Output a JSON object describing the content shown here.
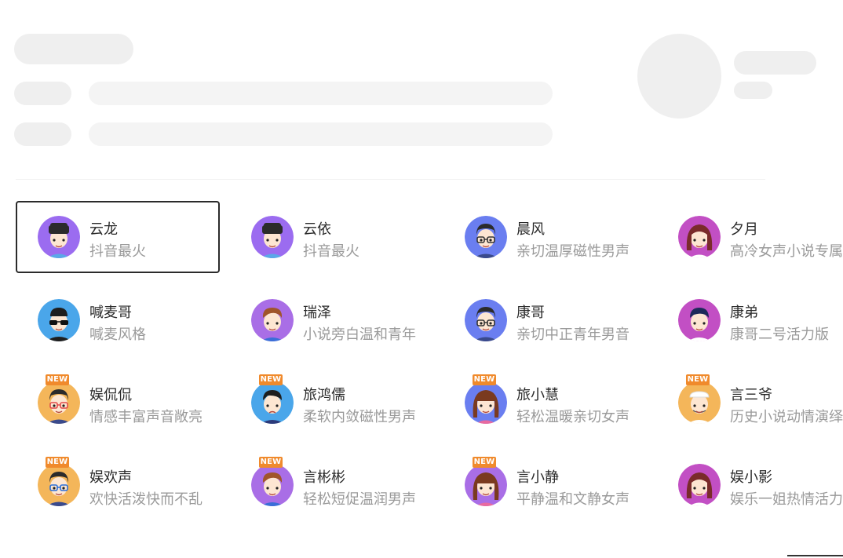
{
  "voices": [
    {
      "name": "云龙",
      "desc": "抖音最火",
      "new": false,
      "selected": true,
      "bg": "#9b6cf0",
      "avatar": "boy-cap"
    },
    {
      "name": "云依",
      "desc": "抖音最火",
      "new": false,
      "selected": false,
      "bg": "#9b6cf0",
      "avatar": "boy-cap"
    },
    {
      "name": "晨风",
      "desc": "亲切温厚磁性男声",
      "new": false,
      "selected": false,
      "bg": "#6a7ef0",
      "avatar": "man-glasses"
    },
    {
      "name": "夕月",
      "desc": "高冷女声小说专属",
      "new": false,
      "selected": false,
      "bg": "#c24fc4",
      "avatar": "woman-long-hair"
    },
    {
      "name": "喊麦哥",
      "desc": "喊麦风格",
      "new": false,
      "selected": false,
      "bg": "#4aa6ea",
      "avatar": "man-sunglasses"
    },
    {
      "name": "瑞泽",
      "desc": "小说旁白温和青年",
      "new": false,
      "selected": false,
      "bg": "#a96ee6",
      "avatar": "young-man"
    },
    {
      "name": "康哥",
      "desc": "亲切中正青年男音",
      "new": false,
      "selected": false,
      "bg": "#6a7ef0",
      "avatar": "man-glasses"
    },
    {
      "name": "康弟",
      "desc": "康哥二号活力版",
      "new": false,
      "selected": false,
      "bg": "#c24fc4",
      "avatar": "boy"
    },
    {
      "name": "娱侃侃",
      "desc": "情感丰富声音敞亮",
      "new": true,
      "selected": false,
      "bg": "#f4b65a",
      "avatar": "man-glasses-color"
    },
    {
      "name": "旅鸿儒",
      "desc": "柔软内敛磁性男声",
      "new": true,
      "selected": false,
      "bg": "#4aa6ea",
      "avatar": "man-sad"
    },
    {
      "name": "旅小慧",
      "desc": "轻松温暖亲切女声",
      "new": true,
      "selected": false,
      "bg": "#6a7ef0",
      "avatar": "girl-bangs"
    },
    {
      "name": "言三爷",
      "desc": "历史小说动情演绎",
      "new": true,
      "selected": false,
      "bg": "#f4b65a",
      "avatar": "old-man"
    },
    {
      "name": "娱欢声",
      "desc": "欢快活泼快而不乱",
      "new": true,
      "selected": false,
      "bg": "#f4b65a",
      "avatar": "man-glasses-blue"
    },
    {
      "name": "言彬彬",
      "desc": "轻松短促温润男声",
      "new": true,
      "selected": false,
      "bg": "#a96ee6",
      "avatar": "young-man"
    },
    {
      "name": "言小静",
      "desc": "平静温和文静女声",
      "new": true,
      "selected": false,
      "bg": "#a96ee6",
      "avatar": "girl-long"
    },
    {
      "name": "娱小影",
      "desc": "娱乐一姐热情活力",
      "new": false,
      "selected": false,
      "bg": "#c24fc4",
      "avatar": "woman-long-hair"
    }
  ],
  "badge_label": "NEW"
}
